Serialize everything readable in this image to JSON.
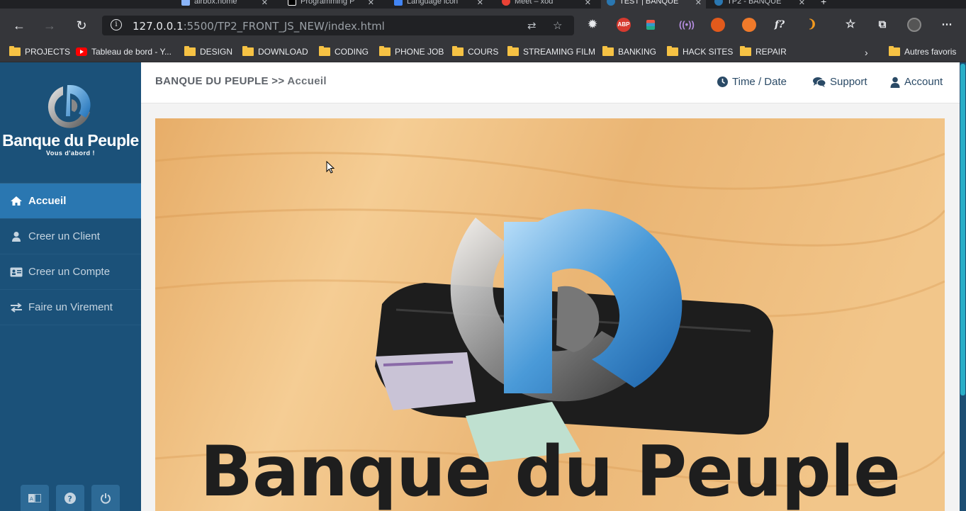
{
  "browser": {
    "tabs": [
      {
        "title": "airbox.home"
      },
      {
        "title": "Programming P"
      },
      {
        "title": "Language icon"
      },
      {
        "title": "Meet – xod"
      },
      {
        "title": "TEST | BANQUE"
      },
      {
        "title": "TP2 - BANQUE"
      }
    ],
    "url_host": "127.0.0.1",
    "url_rest": ":5500/TP2_FRONT_JS_NEW/index.html",
    "extensions": [
      "settings-extension-icon",
      "adblock-plus-icon",
      "stack-extension-icon",
      "radio-extension-icon",
      "fire-extension-icon",
      "flame-extension-icon",
      "formula-extension-icon",
      "orange-extension-icon"
    ],
    "ext_abp_label": "ABP",
    "ext_formula_label": "f?",
    "bookmarks": [
      {
        "label": "PROJECTS",
        "icon": "folder-icon"
      },
      {
        "label": "Tableau de bord - Y...",
        "icon": "youtube-icon"
      },
      {
        "label": "DESIGN",
        "icon": "folder-icon"
      },
      {
        "label": "DOWNLOAD",
        "icon": "folder-icon"
      },
      {
        "label": "CODING",
        "icon": "folder-icon"
      },
      {
        "label": "PHONE JOB",
        "icon": "folder-icon"
      },
      {
        "label": "COURS",
        "icon": "folder-icon"
      },
      {
        "label": "STREAMING FILM",
        "icon": "folder-icon"
      },
      {
        "label": "BANKING",
        "icon": "folder-icon"
      },
      {
        "label": "HACK SITES",
        "icon": "folder-icon"
      },
      {
        "label": "REPAIR",
        "icon": "folder-icon"
      }
    ],
    "other_bookmarks": "Autres favoris"
  },
  "sidebar": {
    "brand_name": "Banque du Peuple",
    "tagline": "Vous d'abord !",
    "menu": [
      {
        "label": "Accueil",
        "icon": "home-icon",
        "active": true
      },
      {
        "label": "Creer un Client",
        "icon": "user-icon",
        "active": false
      },
      {
        "label": "Creer un Compte",
        "icon": "id-card-icon",
        "active": false
      },
      {
        "label": "Faire un Virement",
        "icon": "exchange-icon",
        "active": false
      }
    ],
    "footer_buttons": [
      "language-icon",
      "help-icon",
      "power-icon"
    ]
  },
  "topbar": {
    "site": "BANQUE DU PEUPLE",
    "separator": ">>",
    "current": "Accueil",
    "links": [
      {
        "label": "Time / Date",
        "icon": "clock-icon"
      },
      {
        "label": "Support",
        "icon": "comments-icon"
      },
      {
        "label": "Account",
        "icon": "user-icon"
      }
    ]
  },
  "hero": {
    "title": "Banque du Peuple"
  },
  "colors": {
    "sidebar": "#1b5179",
    "sidebar_active": "#2a77b1",
    "accent": "#2aaec7"
  }
}
